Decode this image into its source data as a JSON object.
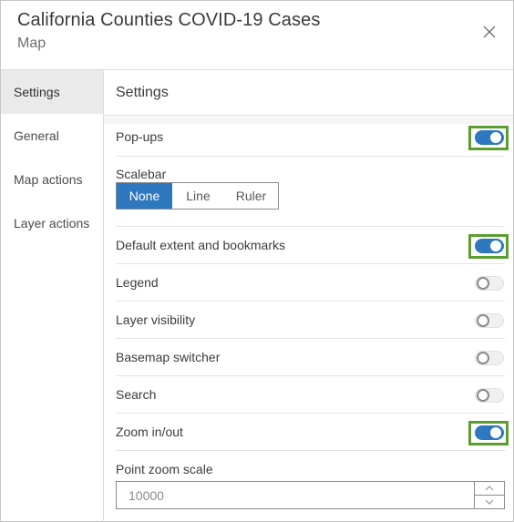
{
  "header": {
    "title": "California Counties COVID-19 Cases",
    "subtitle": "Map",
    "close_icon": "close-icon"
  },
  "sidebar": {
    "items": [
      {
        "label": "Settings",
        "active": true
      },
      {
        "label": "General",
        "active": false
      },
      {
        "label": "Map actions",
        "active": false
      },
      {
        "label": "Layer actions",
        "active": false
      }
    ]
  },
  "content": {
    "title": "Settings",
    "popups": {
      "label": "Pop-ups",
      "on": true,
      "highlighted": true
    },
    "scalebar": {
      "label": "Scalebar",
      "options": [
        "None",
        "Line",
        "Ruler"
      ],
      "selected": "None"
    },
    "toggles": [
      {
        "label": "Default extent and bookmarks",
        "on": true,
        "highlighted": true
      },
      {
        "label": "Legend",
        "on": false,
        "highlighted": false
      },
      {
        "label": "Layer visibility",
        "on": false,
        "highlighted": false
      },
      {
        "label": "Basemap switcher",
        "on": false,
        "highlighted": false
      },
      {
        "label": "Search",
        "on": false,
        "highlighted": false
      },
      {
        "label": "Zoom in/out",
        "on": true,
        "highlighted": true
      }
    ],
    "point_zoom_scale": {
      "label": "Point zoom scale",
      "value": "10000"
    }
  },
  "colors": {
    "accent": "#2e78c0",
    "highlight": "#5a9e2f",
    "sidebar_active": "#eaeaea"
  }
}
